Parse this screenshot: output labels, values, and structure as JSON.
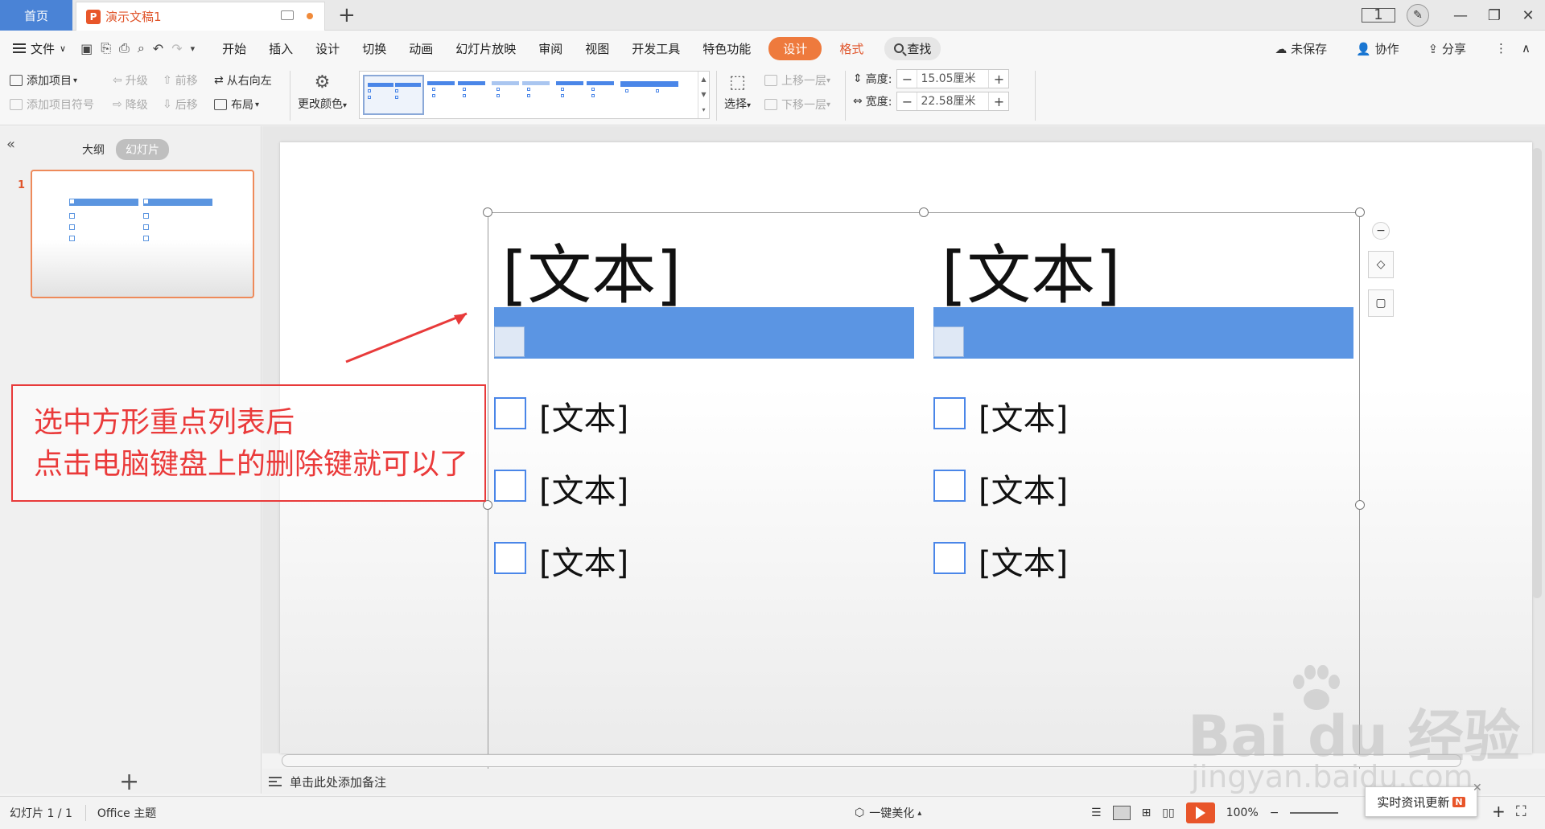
{
  "titlebar": {
    "home_tab": "首页",
    "doc_tab": "演示文稿1",
    "new_tab": "+",
    "page_badge": "1"
  },
  "menu": {
    "file": "文件",
    "items": [
      "开始",
      "插入",
      "设计",
      "切换",
      "动画",
      "幻灯片放映",
      "审阅",
      "视图",
      "开发工具",
      "特色功能"
    ],
    "design_tab": "设计",
    "format_tab": "格式",
    "search": "查找",
    "unsaved": "未保存",
    "collab": "协作",
    "share": "分享"
  },
  "ribbon": {
    "add_item": "添加项目",
    "add_bullet": "添加项目符号",
    "promote": "升级",
    "demote": "降级",
    "move_forward": "前移",
    "move_back": "后移",
    "rtl": "从右向左",
    "layout": "布局",
    "change_color": "更改颜色",
    "select": "选择",
    "bring_forward": "上移一层",
    "send_backward": "下移一层",
    "height_label": "高度:",
    "height_value": "15.05厘米",
    "width_label": "宽度:",
    "width_value": "22.58厘米"
  },
  "leftpanel": {
    "outline_tab": "大纲",
    "slides_tab": "幻灯片",
    "slide_number": "1",
    "add_slide": "+"
  },
  "slide": {
    "col1_title": "[文本]",
    "col2_title": "[文本]",
    "col1_items": [
      "[文本]",
      "[文本]",
      "[文本]"
    ],
    "col2_items": [
      "[文本]",
      "[文本]",
      "[文本]"
    ]
  },
  "annotation": {
    "line1": "选中方形重点列表后",
    "line2": "点击电脑键盘上的删除键就可以了",
    "color": "#ea3a3a"
  },
  "notes": {
    "placeholder": "单击此处添加备注"
  },
  "statusbar": {
    "slide_info": "幻灯片 1 / 1",
    "theme": "Office 主题",
    "beautify": "一键美化",
    "zoom": "100%"
  },
  "news": {
    "label": "实时资讯更新",
    "badge": "N"
  },
  "watermark": {
    "brand": "Bai du 经验",
    "url": "jingyan.baidu.com"
  },
  "colors": {
    "accent": "#ee7a3d",
    "home_tab": "#4a83d6",
    "smartart_blue": "#5b95e3"
  }
}
